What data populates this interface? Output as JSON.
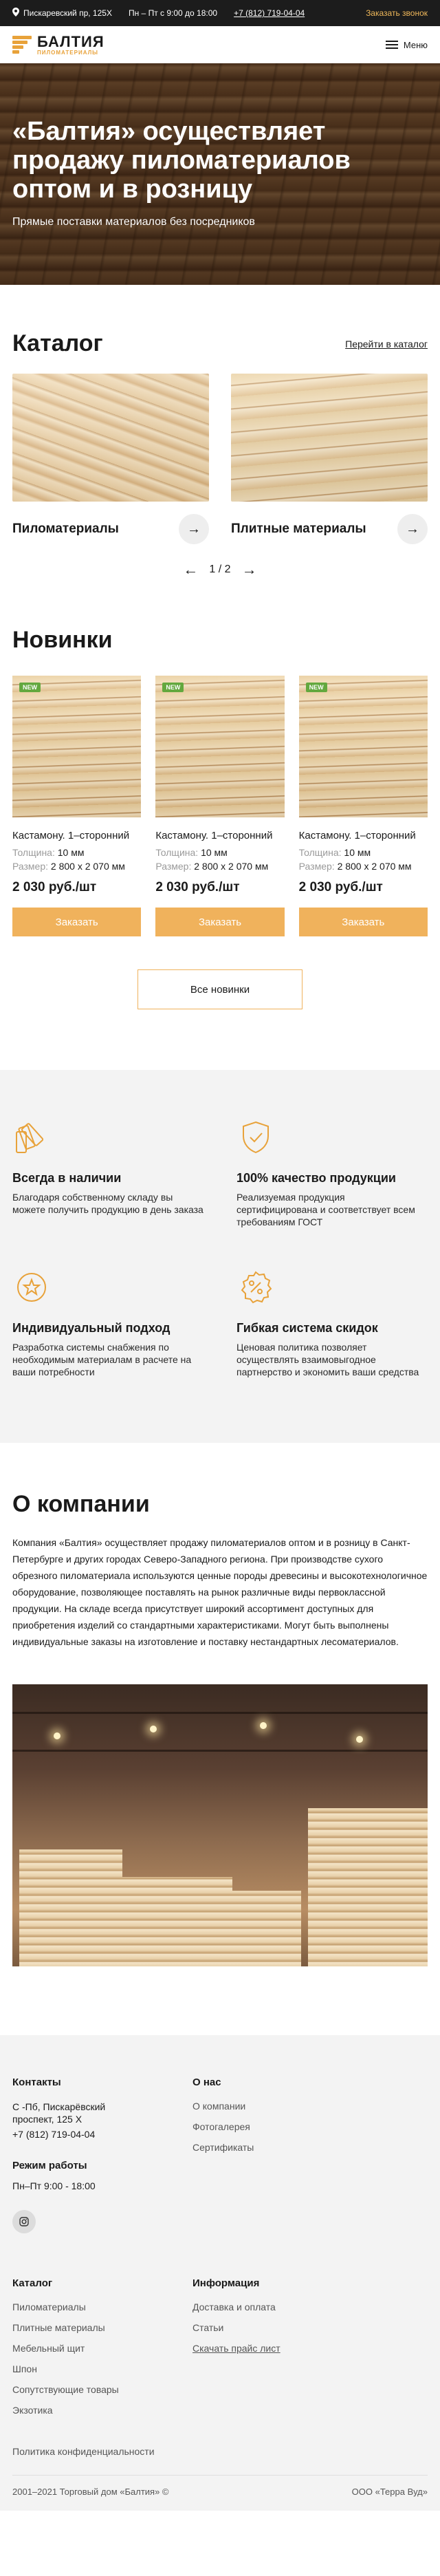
{
  "topbar": {
    "address": "Пискаревский пр, 125Х",
    "hours": "Пн – Пт с 9:00 до 18:00",
    "phone": "+7 (812) 719-04-04",
    "callback": "Заказать звонок"
  },
  "header": {
    "logo_name": "БАЛТИЯ",
    "logo_sub": "ПИЛОМАТЕРИАЛЫ",
    "menu_label": "Меню"
  },
  "hero": {
    "title": "«Балтия» осуществляет продажу пиломатериалов оптом и в розницу",
    "subtitle": "Прямые поставки материалов без посредников"
  },
  "catalog": {
    "title": "Каталог",
    "link": "Перейти в каталог",
    "items": [
      {
        "name": "Пиломатериалы"
      },
      {
        "name": "Плитные материалы"
      }
    ],
    "pager": "1 / 2"
  },
  "news": {
    "title": "Новинки",
    "badge": "NEW",
    "products": [
      {
        "title": "Кастамону. 1–сторонний",
        "thickness_label": "Толщина:",
        "thickness": "10 мм",
        "size_label": "Размер:",
        "size": "2 800 х 2 070 мм",
        "price": "2 030 руб./шт",
        "order": "Заказать"
      },
      {
        "title": "Кастамону. 1–сторонний",
        "thickness_label": "Толщина:",
        "thickness": "10 мм",
        "size_label": "Размер:",
        "size": "2 800 х 2 070 мм",
        "price": "2 030 руб./шт",
        "order": "Заказать"
      },
      {
        "title": "Кастамону. 1–сторонний",
        "thickness_label": "Толщина:",
        "thickness": "10 мм",
        "size_label": "Размер:",
        "size": "2 800 х 2 070 мм",
        "price": "2 030 руб./шт",
        "order": "Заказать"
      }
    ],
    "all_button": "Все новинки"
  },
  "features": [
    {
      "icon": "swatches-icon",
      "title": "Всегда в наличии",
      "text": "Благодаря собственному складу вы можете получить продукцию в день заказа"
    },
    {
      "icon": "shield-check-icon",
      "title": "100% качество продукции",
      "text": "Реализуемая продукция сертифицирована и соответствует всем требованиям ГОСТ"
    },
    {
      "icon": "star-badge-icon",
      "title": "Индивидуальный подход",
      "text": "Разработка системы снабжения по необходимым материалам в расчете на ваши потребности"
    },
    {
      "icon": "percent-badge-icon",
      "title": "Гибкая система скидок",
      "text": "Ценовая политика позволяет осуществлять взаимовыгодное партнерство и экономить ваши средства"
    }
  ],
  "about": {
    "title": "О компании",
    "text": "Компания «Балтия» осуществляет продажу пиломатериалов оптом и в розницу в Санкт-Петербурге и других городах Северо-Западного региона. При производстве сухого обрезного пиломатериала используются ценные породы древесины и высокотехнологичное оборудование, позволяющее поставлять на рынок различные виды первоклассной продукции. На складе всегда присутствует широкий ассортимент доступных для приобретения изделий со стандартными характеристиками. Могут быть выполнены индивидуальные заказы на изготовление и поставку нестандартных лесоматериалов."
  },
  "footer": {
    "contacts_title": "Контакты",
    "address": "С -Пб, Пискарёвский проспект, 125 Х",
    "phone": "+7 (812) 719-04-04",
    "hours_title": "Режим работы",
    "hours": "Пн–Пт  9:00 - 18:00",
    "about_title": "О нас",
    "about_links": [
      "О компании",
      "Фотогалерея",
      "Сертификаты"
    ],
    "catalog_title": "Каталог",
    "catalog_links": [
      "Пиломатериалы",
      "Плитные материалы",
      "Мебельный щит",
      "Шпон",
      "Сопутствующие товары",
      "Экзотика"
    ],
    "info_title": "Информация",
    "info_links": [
      "Доставка и оплата",
      "Статьи",
      "Скачать прайс лист"
    ],
    "policy": "Политика конфиденциальности",
    "copyright_left": "2001–2021 Торговый дом «Балтия» ©",
    "copyright_right": "ООО «Терра Вуд»"
  }
}
